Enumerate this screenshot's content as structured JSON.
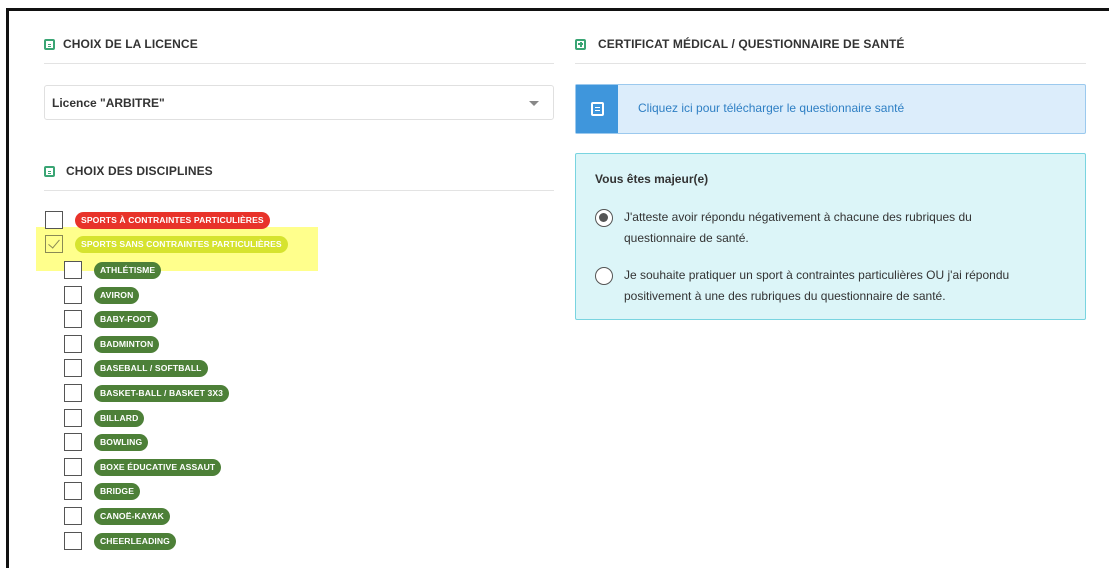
{
  "licence": {
    "title": "CHOIX DE LA LICENCE",
    "selected": "Licence \"ARBITRE\""
  },
  "disciplines": {
    "title": "CHOIX DES DISCIPLINES",
    "groups": [
      {
        "label": "SPORTS À CONTRAINTES PARTICULIÈRES",
        "checked": false,
        "color": "#e8332a"
      },
      {
        "label": "SPORTS SANS CONTRAINTES PARTICULIÈRES",
        "checked": true,
        "color": "#d6e32f"
      }
    ],
    "items": [
      "ATHLÉTISME",
      "AVIRON",
      "BABY-FOOT",
      "BADMINTON",
      "BASEBALL / SOFTBALL",
      "BASKET-BALL / BASKET 3X3",
      "BILLARD",
      "BOWLING",
      "BOXE ÉDUCATIVE ASSAUT",
      "BRIDGE",
      "CANOË-KAYAK",
      "CHEERLEADING"
    ],
    "item_color": "#4d8038"
  },
  "certificat": {
    "title": "CERTIFICAT MÉDICAL / QUESTIONNAIRE DE SANTÉ",
    "download_link": "Cliquez ici pour télécharger le questionnaire santé",
    "majeur_title": "Vous êtes majeur(e)",
    "options": [
      {
        "text": "J'atteste avoir répondu négativement à chacune des rubriques du questionnaire de santé.",
        "selected": true
      },
      {
        "text": "Je souhaite pratiquer un sport à contraintes particulières OU j'ai répondu positivement à une des rubriques du questionnaire de santé.",
        "selected": false
      }
    ]
  },
  "colors": {
    "accent": "#3aa574",
    "info_blue": "#3f96dc",
    "highlight": "#ffff66"
  }
}
